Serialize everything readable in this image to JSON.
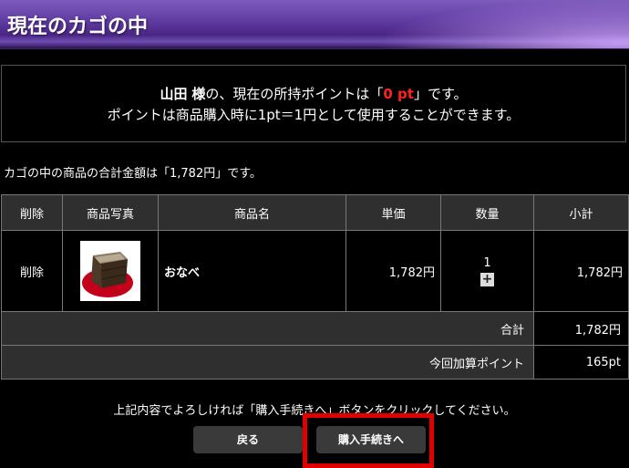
{
  "header": {
    "title": "現在のカゴの中"
  },
  "points": {
    "user_name": "山田",
    "honorific": "様",
    "line1_mid": "の、現在の所持ポイントは「",
    "points_value": "0 pt",
    "line1_end": "」です。",
    "line2": "ポイントは商品購入時に1pt＝1円として使用することができます。"
  },
  "total_message": "カゴの中の商品の合計金額は「1,782円」です。",
  "table": {
    "headers": [
      "削除",
      "商品写真",
      "商品名",
      "単価",
      "数量",
      "小計"
    ],
    "rows": [
      {
        "delete_label": "削除",
        "product_name": "おなべ",
        "unit_price": "1,782円",
        "quantity": "1",
        "subtotal": "1,782円"
      }
    ],
    "total_label": "合計",
    "total_value": "1,782円",
    "points_label": "今回加算ポイント",
    "points_value": "165pt"
  },
  "confirm_message": "上記内容でよろしければ「購入手続きへ」ボタンをクリックしてください。",
  "buttons": {
    "back": "戻る",
    "checkout": "購入手続きへ"
  },
  "colors": {
    "points_highlight": "#ff2020",
    "callout_border": "#e10000"
  }
}
